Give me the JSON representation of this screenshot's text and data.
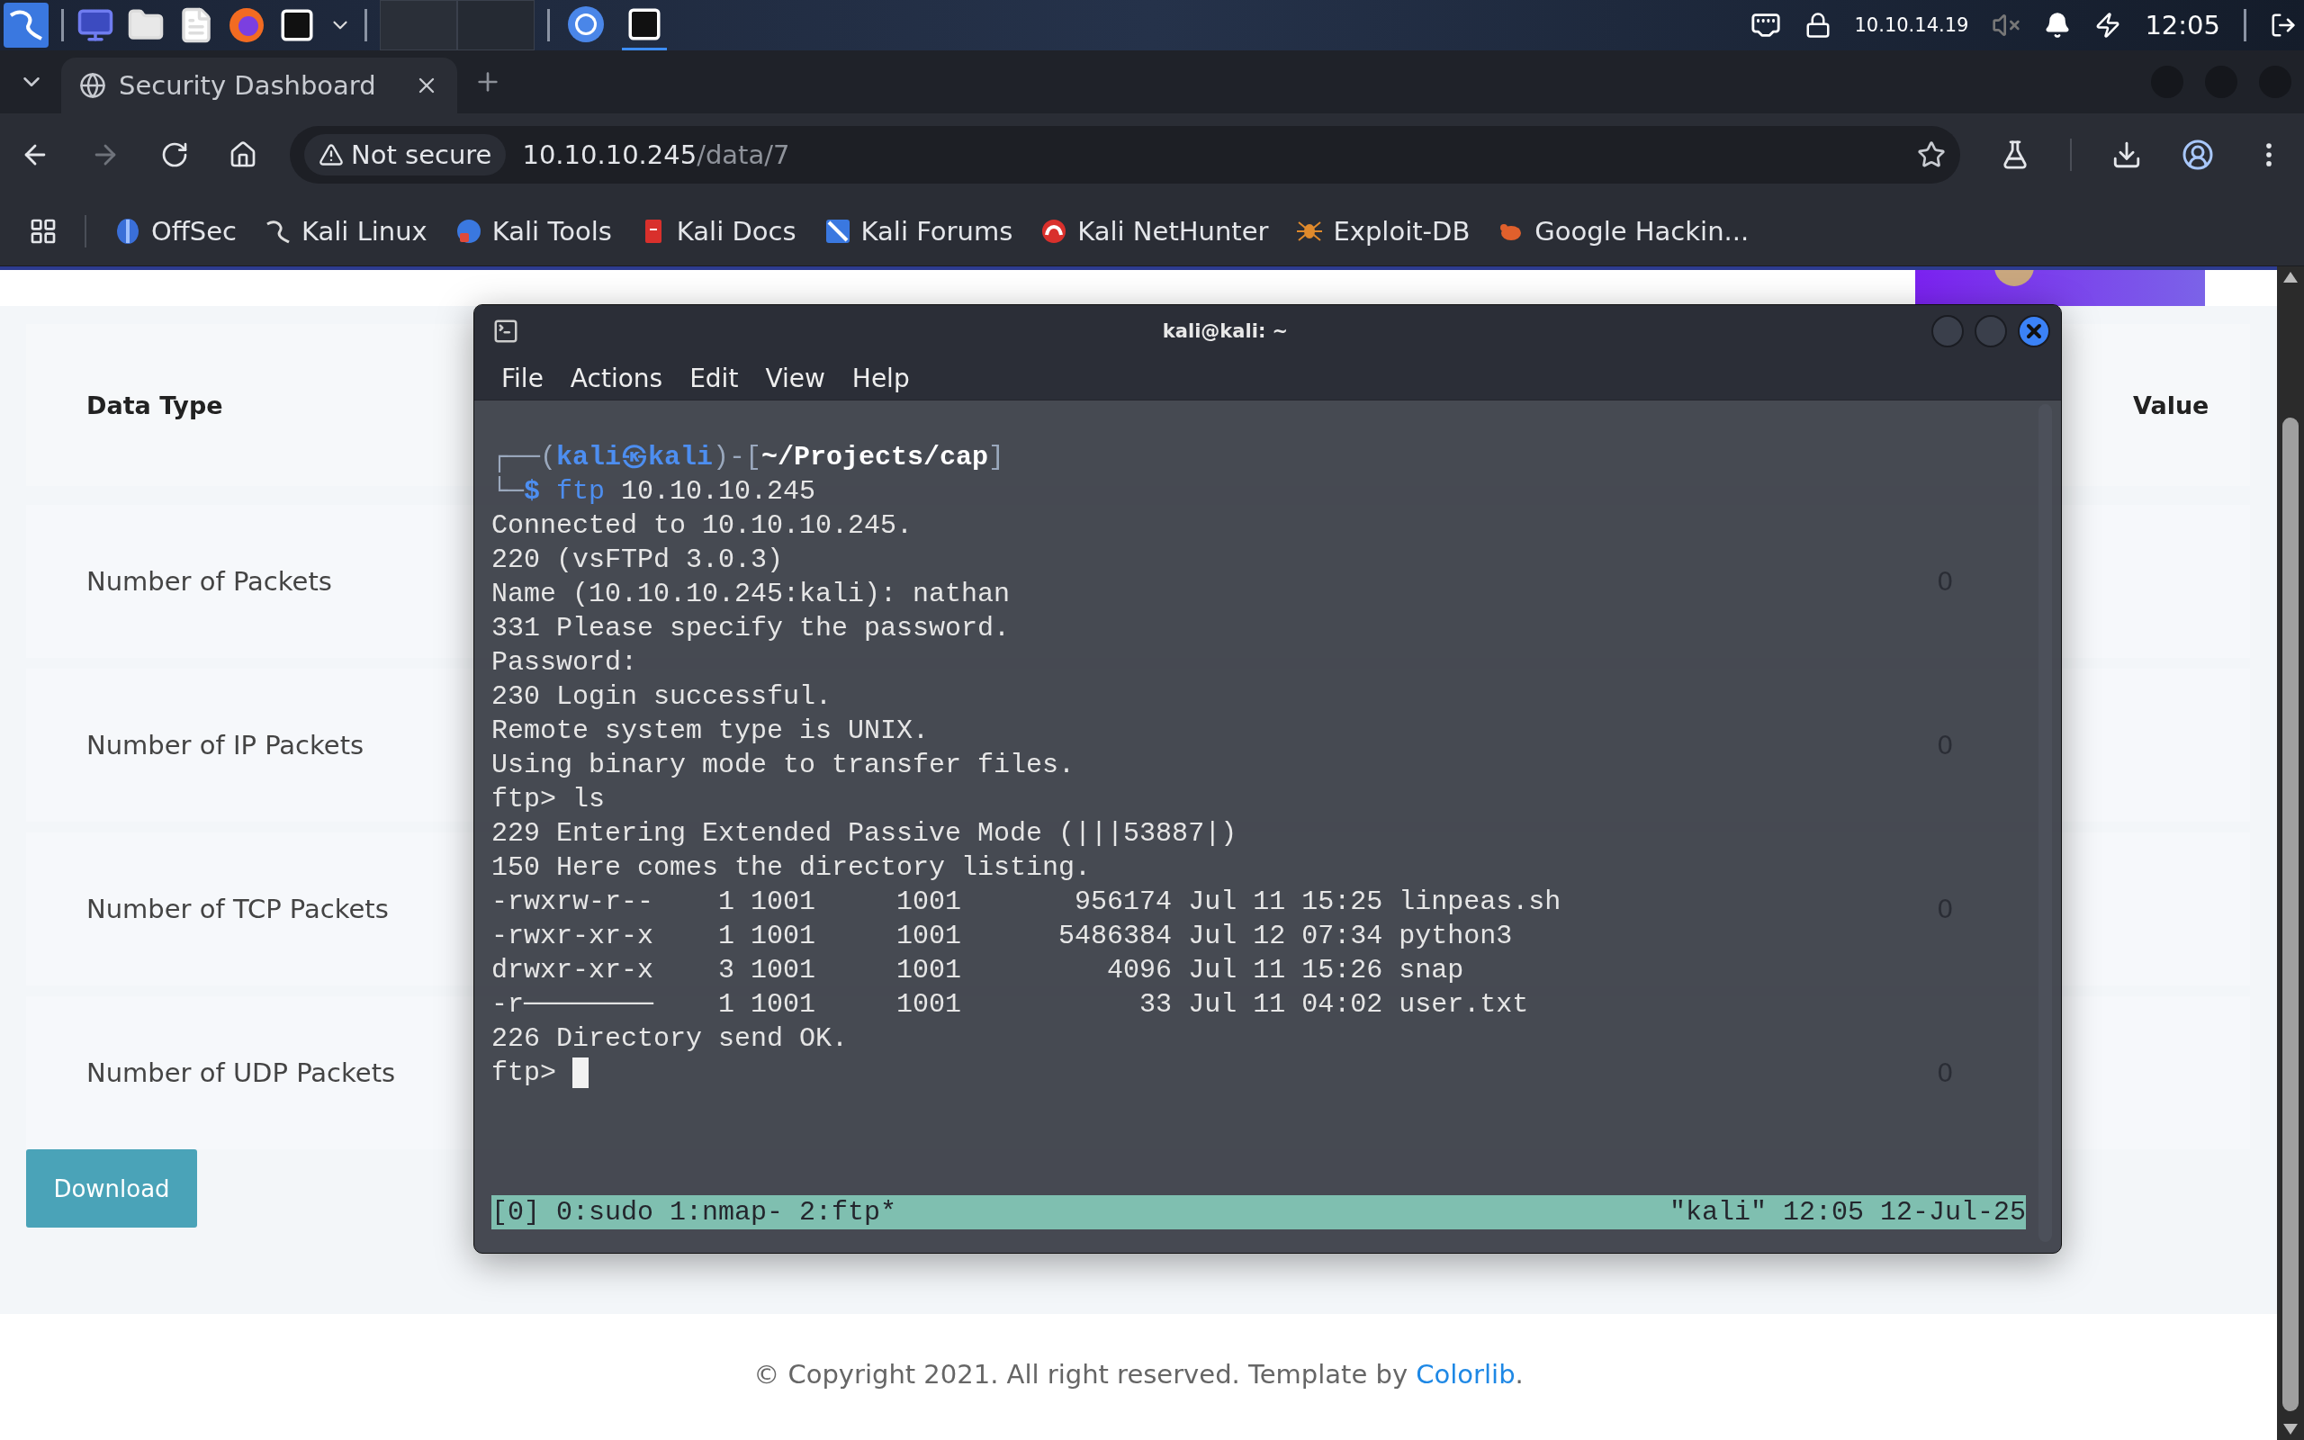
{
  "taskbar": {
    "tasks": [
      {
        "kind": "browser",
        "active": false
      },
      {
        "kind": "terminal",
        "active": true
      }
    ],
    "ip": "10.10.14.19",
    "clock": "12:05"
  },
  "browser": {
    "tabs": [
      {
        "title": "Security Dashboard",
        "selected": true
      }
    ],
    "address": {
      "security": "Not secure",
      "host": "10.10.10.245",
      "path": "/data/7"
    },
    "bookmarks": [
      {
        "label": "OffSec",
        "kind": "offsec"
      },
      {
        "label": "Kali Linux",
        "kind": "dragon"
      },
      {
        "label": "Kali Tools",
        "kind": "tools"
      },
      {
        "label": "Kali Docs",
        "kind": "docs"
      },
      {
        "label": "Kali Forums",
        "kind": "forums"
      },
      {
        "label": "Kali NetHunter",
        "kind": "nethunter"
      },
      {
        "label": "Exploit-DB",
        "kind": "spider"
      },
      {
        "label": "Google Hackin...",
        "kind": "bug"
      }
    ]
  },
  "page": {
    "table": {
      "columns": [
        "Data Type",
        "Value"
      ],
      "rows": [
        {
          "label": "Number of Packets",
          "value": "0"
        },
        {
          "label": "Number of IP Packets",
          "value": "0"
        },
        {
          "label": "Number of TCP Packets",
          "value": "0"
        },
        {
          "label": "Number of UDP Packets",
          "value": "0"
        }
      ]
    },
    "button": "Download",
    "footer": {
      "text": "© Copyright 2021. All right reserved. Template by ",
      "link": "Colorlib",
      "end": "."
    }
  },
  "terminal": {
    "title": "kali@kali: ~",
    "menu": [
      "File",
      "Actions",
      "Edit",
      "View",
      "Help"
    ],
    "prompt": {
      "corner_top": "┌──(",
      "user": "kali㉿kali",
      "separator": ")-[",
      "path": "~/Projects/cap",
      "close": "]",
      "corner_bottom": "└─",
      "sign": "$",
      "command": "ftp",
      "argument": "10.10.10.245"
    },
    "lines": [
      "Connected to 10.10.10.245.",
      "220 (vsFTPd 3.0.3)",
      "Name (10.10.10.245:kali): nathan",
      "331 Please specify the password.",
      "Password:",
      "230 Login successful.",
      "Remote system type is UNIX.",
      "Using binary mode to transfer files.",
      "ftp> ls",
      "229 Entering Extended Passive Mode (|||53887|)",
      "150 Here comes the directory listing.",
      "-rwxrw-r--    1 1001     1001       956174 Jul 11 15:25 linpeas.sh",
      "-rwxr-xr-x    1 1001     1001      5486384 Jul 12 07:34 python3",
      "drwxr-xr-x    3 1001     1001         4096 Jul 11 15:26 snap",
      "-r────────    1 1001     1001           33 Jul 11 04:02 user.txt",
      "226 Directory send OK."
    ],
    "input": {
      "prompt": "ftp>",
      "cursor": true
    },
    "status": {
      "left": "[0] 0:sudo  1:nmap- 2:ftp*",
      "right": "\"kali\" 12:05 12-Jul-25"
    }
  }
}
